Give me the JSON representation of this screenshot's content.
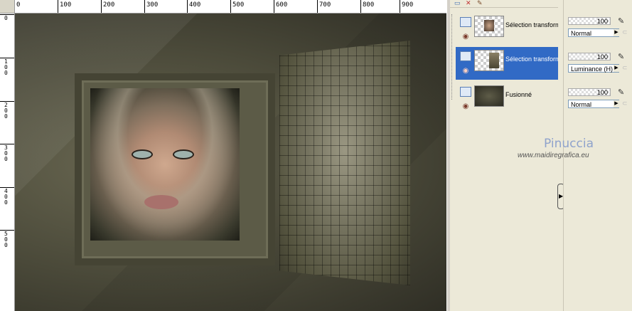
{
  "ruler": {
    "top_labels": [
      "0",
      "100",
      "200",
      "300",
      "400",
      "500",
      "600",
      "700",
      "800",
      "900"
    ],
    "left_labels": [
      "0",
      "100",
      "200",
      "300",
      "400",
      "500"
    ]
  },
  "canvas": {
    "description_hidden": ""
  },
  "layers": {
    "items": [
      {
        "name": "Sélection transform",
        "selected": false
      },
      {
        "name": "Sélection transform",
        "selected": true
      },
      {
        "name": "Fusionné",
        "selected": false
      }
    ]
  },
  "properties": {
    "groups": [
      {
        "opacity": "100",
        "blend": "Normal"
      },
      {
        "opacity": "100",
        "blend": "Luminance (H)"
      },
      {
        "opacity": "100",
        "blend": "Normal"
      }
    ]
  },
  "watermark": {
    "name": "Pinuccia",
    "url": "www.maidiregrafica.eu"
  },
  "colors": {
    "selection": "#316ac5",
    "panel_bg": "#ece9d8",
    "canvas_dark": "#4b4a3a"
  },
  "icons": [
    "paintbrush-icon",
    "eye-icon",
    "layer-raster-icon",
    "delete-layer-icon",
    "new-layer-icon",
    "lock-icon",
    "expand-arrow-icon"
  ]
}
